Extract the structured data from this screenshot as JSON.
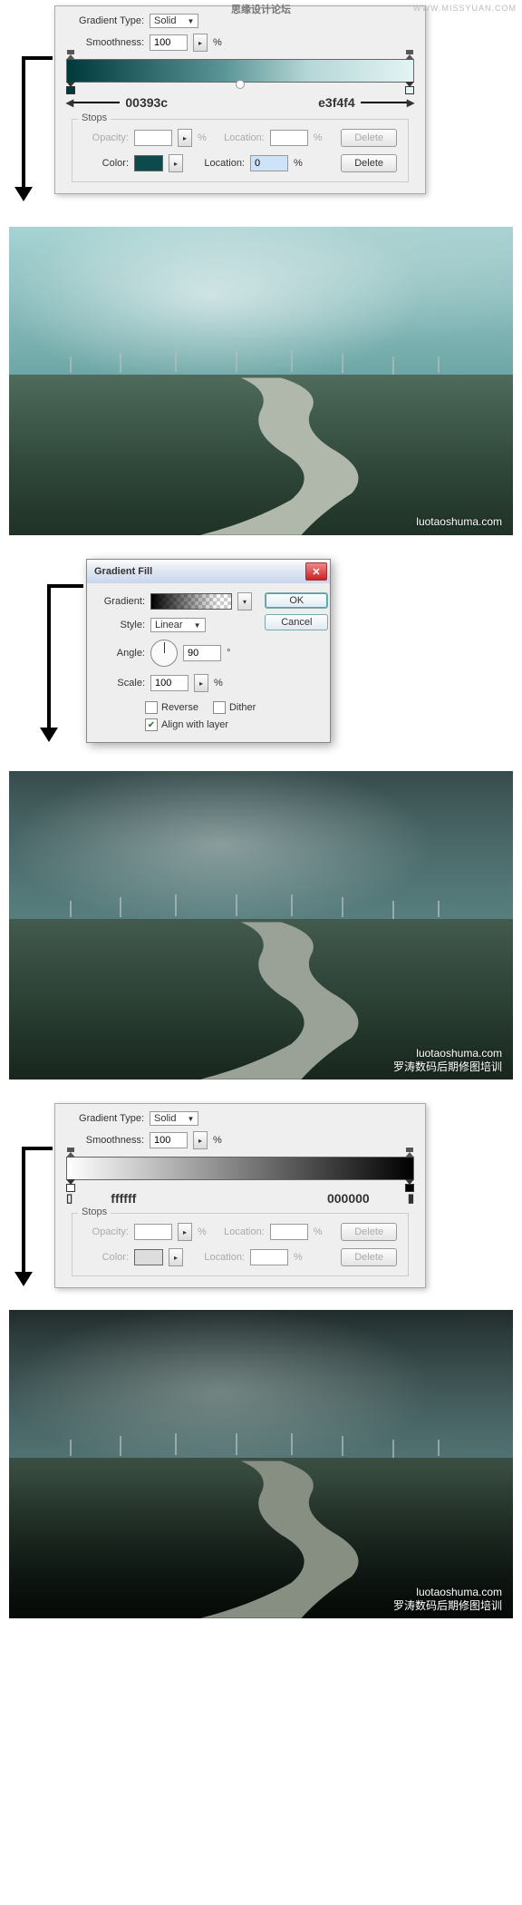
{
  "header": {
    "watermark1": "思缘设计论坛",
    "watermark2": "WWW.MISSYUAN.COM"
  },
  "gradEditor1": {
    "typeLabel": "Gradient Type:",
    "typeValue": "Solid",
    "smoothLabel": "Smoothness:",
    "smoothValue": "100",
    "pct": "%",
    "leftHex": "00393c",
    "rightHex": "e3f4f4",
    "stopsTitle": "Stops",
    "opacityLabel": "Opacity:",
    "colorLabel": "Color:",
    "locationLabel": "Location:",
    "location2Value": "0",
    "deleteLabel": "Delete",
    "swatch": "#0c4a4e"
  },
  "gradFill": {
    "title": "Gradient Fill",
    "gradientLabel": "Gradient:",
    "styleLabel": "Style:",
    "styleValue": "Linear",
    "angleLabel": "Angle:",
    "angleValue": "90",
    "deg": "°",
    "scaleLabel": "Scale:",
    "scaleValue": "100",
    "pct": "%",
    "reverseLabel": "Reverse",
    "ditherLabel": "Dither",
    "alignLabel": "Align with layer",
    "ok": "OK",
    "cancel": "Cancel"
  },
  "gradEditor2": {
    "typeLabel": "Gradient Type:",
    "typeValue": "Solid",
    "smoothLabel": "Smoothness:",
    "smoothValue": "100",
    "pct": "%",
    "leftHex": "ffffff",
    "rightHex": "000000",
    "stopsTitle": "Stops",
    "opacityLabel": "Opacity:",
    "colorLabel": "Color:",
    "locationLabel": "Location:",
    "deleteLabel": "Delete"
  },
  "images": {
    "wmUrl": "luotaoshuma.com",
    "wmText": "罗涛数码后期修图培训"
  }
}
